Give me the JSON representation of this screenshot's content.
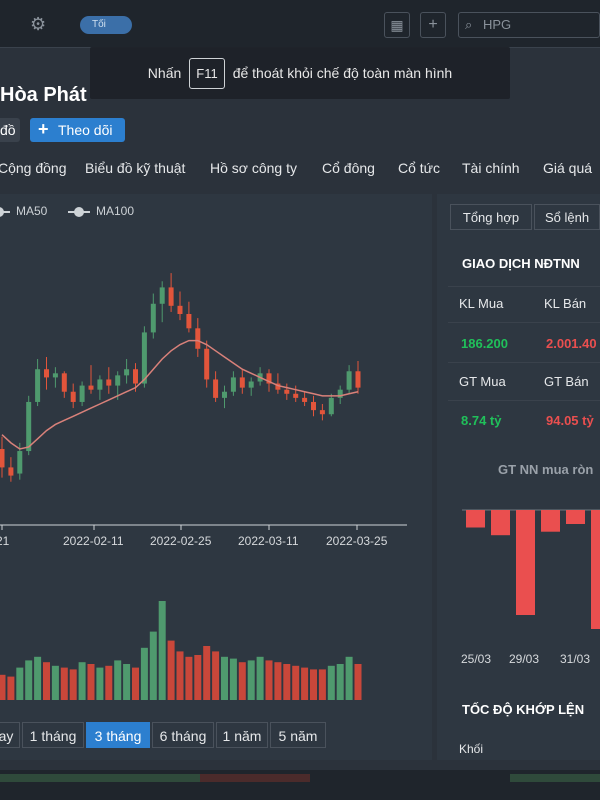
{
  "topbar": {
    "toggle_label": "Tối",
    "search_value": "HPG",
    "icons": [
      "gear-icon",
      "grid-icon",
      "plus-icon",
      "search-icon"
    ]
  },
  "toast": {
    "prefix": "Nhấn",
    "key": "F11",
    "suffix": "để thoát khỏi chế độ toàn màn hình"
  },
  "stock": {
    "title": "Hòa Phát",
    "partial_button_label": "đồ",
    "follow_label": "Theo dõi"
  },
  "tabs": [
    {
      "label": "Cộng đồng"
    },
    {
      "label": "Biểu đồ kỹ thuật"
    },
    {
      "label": "Hồ sơ công ty"
    },
    {
      "label": "Cổ đông"
    },
    {
      "label": "Cổ tức"
    },
    {
      "label": "Tài chính"
    },
    {
      "label": "Giá quá"
    }
  ],
  "legend": [
    {
      "label": "MA50"
    },
    {
      "label": "MA100"
    }
  ],
  "chart_data": {
    "type": "candlestick",
    "x_ticks": [
      "21",
      "2022-02-11",
      "2022-02-25",
      "2022-03-11",
      "2022-03-25"
    ],
    "colors": {
      "up": "#4f9a6e",
      "down": "#e2553b",
      "ma": "#d9817a",
      "volume_down": "#c9473a",
      "volume_up": "#4f9a6e"
    },
    "candles": [
      {
        "o": 47.2,
        "h": 47.8,
        "l": 45.8,
        "c": 46.3
      },
      {
        "o": 46.3,
        "h": 46.8,
        "l": 45.6,
        "c": 45.9
      },
      {
        "o": 46.0,
        "h": 47.5,
        "l": 45.7,
        "c": 47.1
      },
      {
        "o": 47.1,
        "h": 49.8,
        "l": 46.9,
        "c": 49.5
      },
      {
        "o": 49.5,
        "h": 51.6,
        "l": 49.3,
        "c": 51.1
      },
      {
        "o": 51.1,
        "h": 51.7,
        "l": 50.1,
        "c": 50.7
      },
      {
        "o": 50.7,
        "h": 51.2,
        "l": 50.2,
        "c": 50.9
      },
      {
        "o": 50.9,
        "h": 51.0,
        "l": 49.7,
        "c": 50.0
      },
      {
        "o": 50.0,
        "h": 50.4,
        "l": 49.2,
        "c": 49.5
      },
      {
        "o": 49.5,
        "h": 50.5,
        "l": 49.3,
        "c": 50.3
      },
      {
        "o": 50.3,
        "h": 51.3,
        "l": 49.9,
        "c": 50.1
      },
      {
        "o": 50.1,
        "h": 50.8,
        "l": 49.6,
        "c": 50.6
      },
      {
        "o": 50.6,
        "h": 51.2,
        "l": 49.9,
        "c": 50.3
      },
      {
        "o": 50.3,
        "h": 51.0,
        "l": 49.6,
        "c": 50.8
      },
      {
        "o": 50.8,
        "h": 51.6,
        "l": 50.4,
        "c": 51.1
      },
      {
        "o": 51.1,
        "h": 51.4,
        "l": 50.0,
        "c": 50.4
      },
      {
        "o": 50.4,
        "h": 53.2,
        "l": 50.2,
        "c": 52.9
      },
      {
        "o": 52.9,
        "h": 54.8,
        "l": 52.6,
        "c": 54.3
      },
      {
        "o": 54.3,
        "h": 55.4,
        "l": 53.4,
        "c": 55.1
      },
      {
        "o": 55.1,
        "h": 55.8,
        "l": 53.9,
        "c": 54.2
      },
      {
        "o": 54.2,
        "h": 54.9,
        "l": 53.5,
        "c": 53.8
      },
      {
        "o": 53.8,
        "h": 54.4,
        "l": 52.9,
        "c": 53.1
      },
      {
        "o": 53.1,
        "h": 53.6,
        "l": 51.7,
        "c": 52.1
      },
      {
        "o": 52.1,
        "h": 52.5,
        "l": 50.2,
        "c": 50.6
      },
      {
        "o": 50.6,
        "h": 51.0,
        "l": 49.5,
        "c": 49.7
      },
      {
        "o": 49.7,
        "h": 50.3,
        "l": 49.2,
        "c": 50.0
      },
      {
        "o": 50.0,
        "h": 51.0,
        "l": 49.8,
        "c": 50.7
      },
      {
        "o": 50.7,
        "h": 51.1,
        "l": 49.9,
        "c": 50.2
      },
      {
        "o": 50.2,
        "h": 50.7,
        "l": 49.8,
        "c": 50.5
      },
      {
        "o": 50.5,
        "h": 51.2,
        "l": 50.3,
        "c": 50.9
      },
      {
        "o": 50.9,
        "h": 51.1,
        "l": 50.0,
        "c": 50.4
      },
      {
        "o": 50.4,
        "h": 50.9,
        "l": 49.9,
        "c": 50.1
      },
      {
        "o": 50.1,
        "h": 50.4,
        "l": 49.6,
        "c": 49.9
      },
      {
        "o": 49.9,
        "h": 50.3,
        "l": 49.5,
        "c": 49.7
      },
      {
        "o": 49.7,
        "h": 50.0,
        "l": 49.3,
        "c": 49.5
      },
      {
        "o": 49.5,
        "h": 49.8,
        "l": 48.8,
        "c": 49.1
      },
      {
        "o": 49.1,
        "h": 49.4,
        "l": 48.6,
        "c": 48.9
      },
      {
        "o": 48.9,
        "h": 49.9,
        "l": 48.8,
        "c": 49.7
      },
      {
        "o": 49.7,
        "h": 50.3,
        "l": 49.4,
        "c": 50.1
      },
      {
        "o": 50.1,
        "h": 51.3,
        "l": 49.9,
        "c": 51.0
      },
      {
        "o": 51.0,
        "h": 51.5,
        "l": 49.9,
        "c": 50.2
      }
    ],
    "ma": [
      47.9,
      47.5,
      47.2,
      47.3,
      47.7,
      48.1,
      48.4,
      48.6,
      48.8,
      49.0,
      49.2,
      49.4,
      49.6,
      49.8,
      50.0,
      50.2,
      50.6,
      51.1,
      51.6,
      52.0,
      52.3,
      52.5,
      52.5,
      52.3,
      52.0,
      51.7,
      51.4,
      51.1,
      50.9,
      50.7,
      50.5,
      50.3,
      50.2,
      50.1,
      50.0,
      49.9,
      49.8,
      49.8,
      49.8,
      49.9,
      50.0
    ],
    "volume": [
      14,
      13,
      18,
      22,
      24,
      21,
      19,
      18,
      17,
      21,
      20,
      18,
      19,
      22,
      20,
      18,
      29,
      38,
      55,
      33,
      27,
      24,
      25,
      30,
      27,
      24,
      23,
      21,
      22,
      24,
      22,
      21,
      20,
      19,
      18,
      17,
      17,
      19,
      20,
      24,
      20
    ],
    "ylim": [
      45,
      56
    ]
  },
  "periods": [
    {
      "label": "ay"
    },
    {
      "label": "1 tháng"
    },
    {
      "label": "3 tháng"
    },
    {
      "label": "6 tháng"
    },
    {
      "label": "1 năm"
    },
    {
      "label": "5 năm"
    }
  ],
  "side": {
    "tabs": [
      "Tổng hợp",
      "Sổ lệnh"
    ],
    "heading": "GIAO DỊCH NĐTNN",
    "kl_mua_label": "KL Mua",
    "kl_ban_label": "KL Bán",
    "kl_mua_value": "186.200",
    "kl_ban_value": "2.001.40",
    "gt_mua_label": "GT Mua",
    "gt_ban_label": "GT Bán",
    "gt_mua_value": "8.74 tỷ",
    "gt_ban_value": "94.05 tỷ",
    "mini_title": "GT NN mua ròn",
    "mini_ticks": [
      "25/03",
      "29/03",
      "31/03"
    ],
    "mini_bars": [
      -2.5,
      -3.6,
      -15,
      -3.1,
      -2.0,
      -17
    ],
    "speed_heading": "TỐC ĐỘ KHỚP LỆN",
    "speed_label": "Khối"
  }
}
